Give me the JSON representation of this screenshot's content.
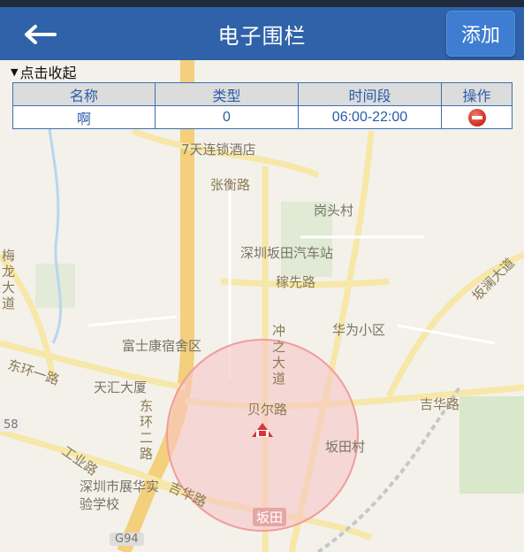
{
  "header": {
    "title": "电子围栏",
    "add_label": "添加"
  },
  "panel": {
    "toggle_label": "点击收起",
    "columns": [
      "名称",
      "类型",
      "时间段",
      "操作"
    ],
    "rows": [
      {
        "name": "啊",
        "type": "0",
        "time_range": "06:00-22:00"
      }
    ]
  },
  "map": {
    "labels": {
      "hotel": "7天连锁酒店",
      "zhangheng_road": "张衡路",
      "gangtou": "岗头村",
      "bus_station": "深圳坂田汽车站",
      "jixian_road": "稼先路",
      "meilong": "梅龙大道",
      "bantian_ave": "坂澜大道",
      "fushikang": "富士康宿舍区",
      "huawei": "华为小区",
      "chongzhi": "冲之大道",
      "donghuan1": "东环一路",
      "tianhui": "天汇大厦",
      "beier": "贝尔路",
      "jihua": "吉华路",
      "donghuan2": "东环二路",
      "bantian_village": "坂田村",
      "gongye": "工业路",
      "jihua2": "吉华路",
      "school": "深圳市展华实验学校",
      "bantian": "坂田",
      "g94": "G94",
      "r58": "58"
    }
  }
}
